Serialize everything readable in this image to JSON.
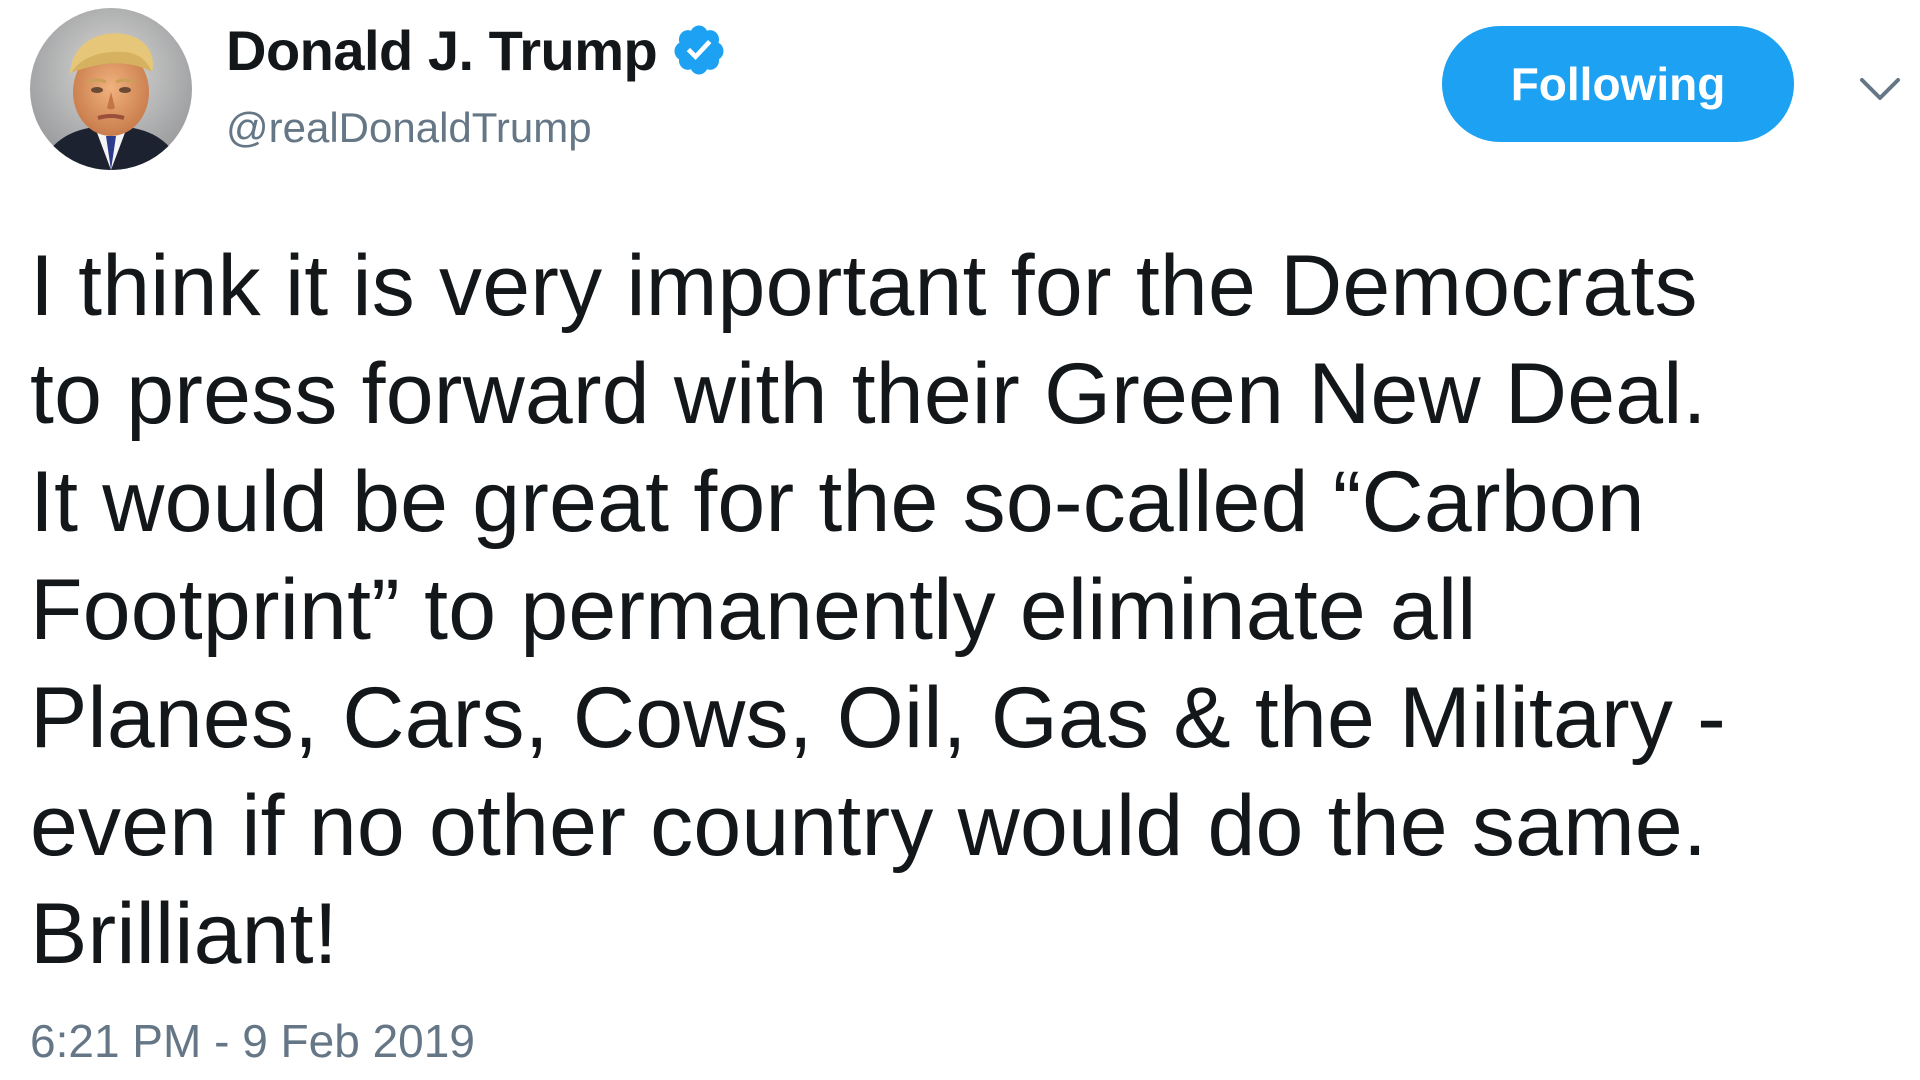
{
  "author": {
    "display_name": "Donald J. Trump",
    "handle": "@realDonaldTrump",
    "verified": true,
    "avatar_icon": "profile-photo"
  },
  "actions": {
    "follow_label": "Following",
    "menu_icon": "chevron-down-icon"
  },
  "tweet": {
    "lines": [
      "I think it is very important for the Democrats",
      "to press forward with their Green New Deal.",
      "It would be great for the so-called “Carbon",
      "Footprint” to permanently eliminate all",
      "Planes, Cars, Cows, Oil, Gas & the Military -",
      "even if no other country would do the same.",
      "Brilliant!"
    ],
    "timestamp": "6:21 PM - 9 Feb 2019"
  },
  "colors": {
    "accent": "#1da1f2",
    "text": "#14171a",
    "secondary_text": "#657786"
  }
}
